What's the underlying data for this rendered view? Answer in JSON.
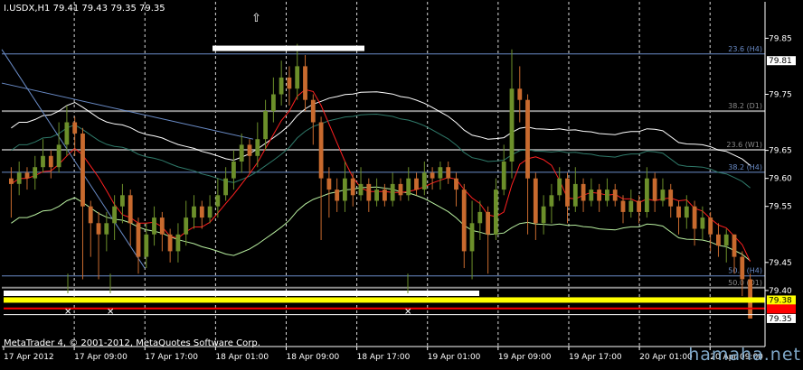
{
  "window": {
    "symbol": "I.USDX,H1",
    "ohlc": "79.41 79.43 79.35 79.35",
    "copyright": "MetaTrader 4, © 2001-2012, MetaQuotes Software Corp.",
    "watermark": "hamaha.net"
  },
  "colors": {
    "background": "#000000",
    "bull": "#6c8f2a",
    "bear": "#c86a2e",
    "fib": "#6a8cc8",
    "gray_level": "#8a8a8a",
    "red_ma": "#ff2020",
    "white_band": "#ffffff",
    "green_line": "#b9f0a0",
    "teal_band": "#2f7a6a",
    "yellow": "#ffff00",
    "red_line": "#ff0000"
  },
  "chart_data": {
    "type": "candlestick",
    "timeframe": "H1",
    "ylim": [
      79.3,
      79.915
    ],
    "y_ticks": [
      "79.85",
      "79.75",
      "79.65",
      "79.60",
      "79.55",
      "79.45",
      "79.40"
    ],
    "x_ticks": [
      "17 Apr 2012",
      "17 Apr 09:00",
      "17 Apr 17:00",
      "18 Apr 01:00",
      "18 Apr 09:00",
      "18 Apr 17:00",
      "19 Apr 01:00",
      "19 Apr 09:00",
      "19 Apr 17:00",
      "20 Apr 01:00",
      "20 Apr 09:00"
    ],
    "price_tags": [
      {
        "label": "79.81",
        "value": 79.81,
        "bg": "#ffffff",
        "fg": "#000000"
      },
      {
        "label": "79.38",
        "value": 79.383,
        "bg": "#ffff00",
        "fg": "#000000"
      },
      {
        "label": "79.35",
        "value": 79.35,
        "bg": "#ffffff",
        "fg": "#000000"
      }
    ],
    "levels": [
      {
        "label": "23.6 (H4)",
        "value": 79.822,
        "color": "#6a8cc8"
      },
      {
        "label": "38.2 (D1)",
        "value": 79.72,
        "color": "#8a8a8a"
      },
      {
        "label": "23.6 (W1)",
        "value": 79.651,
        "color": "#8a8a8a"
      },
      {
        "label": "38.2 (H4)",
        "value": 79.611,
        "color": "#6a8cc8"
      },
      {
        "label": "50.0 (H4)",
        "value": 79.426,
        "color": "#6a8cc8"
      },
      {
        "label": "50.0 (D1)",
        "value": 79.405,
        "color": "#8a8a8a"
      }
    ],
    "candles": [
      [
        79.6,
        79.59,
        79.62,
        79.53
      ],
      [
        79.59,
        79.61,
        79.63,
        79.57
      ],
      [
        79.61,
        79.6,
        79.62,
        79.58
      ],
      [
        79.6,
        79.62,
        79.64,
        79.58
      ],
      [
        79.62,
        79.64,
        79.67,
        79.61
      ],
      [
        79.64,
        79.62,
        79.65,
        79.6
      ],
      [
        79.62,
        79.66,
        79.7,
        79.61
      ],
      [
        79.66,
        79.7,
        79.73,
        79.64
      ],
      [
        79.7,
        79.68,
        79.71,
        79.64
      ],
      [
        79.68,
        79.55,
        79.69,
        79.42
      ],
      [
        79.55,
        79.52,
        79.56,
        79.46
      ],
      [
        79.52,
        79.5,
        79.54,
        79.42
      ],
      [
        79.5,
        79.52,
        79.54,
        79.47
      ],
      [
        79.52,
        79.55,
        79.57,
        79.49
      ],
      [
        79.55,
        79.57,
        79.59,
        79.52
      ],
      [
        79.57,
        79.52,
        79.58,
        79.48
      ],
      [
        79.52,
        79.46,
        79.53,
        79.43
      ],
      [
        79.46,
        79.5,
        79.52,
        79.44
      ],
      [
        79.5,
        79.53,
        79.55,
        79.48
      ],
      [
        79.53,
        79.5,
        79.54,
        79.47
      ],
      [
        79.5,
        79.47,
        79.51,
        79.45
      ],
      [
        79.47,
        79.5,
        79.52,
        79.45
      ],
      [
        79.5,
        79.53,
        79.56,
        79.48
      ],
      [
        79.53,
        79.55,
        79.57,
        79.51
      ],
      [
        79.55,
        79.53,
        79.56,
        79.51
      ],
      [
        79.53,
        79.55,
        79.57,
        79.52
      ],
      [
        79.55,
        79.57,
        79.6,
        79.53
      ],
      [
        79.57,
        79.6,
        79.62,
        79.56
      ],
      [
        79.6,
        79.63,
        79.65,
        79.58
      ],
      [
        79.63,
        79.66,
        79.68,
        79.61
      ],
      [
        79.66,
        79.64,
        79.67,
        79.61
      ],
      [
        79.64,
        79.67,
        79.7,
        79.62
      ],
      [
        79.67,
        79.72,
        79.74,
        79.65
      ],
      [
        79.72,
        79.75,
        79.78,
        79.7
      ],
      [
        79.75,
        79.78,
        79.81,
        79.73
      ],
      [
        79.78,
        79.76,
        79.8,
        79.73
      ],
      [
        79.76,
        79.8,
        79.84,
        79.74
      ],
      [
        79.8,
        79.74,
        79.82,
        79.72
      ],
      [
        79.74,
        79.7,
        79.75,
        79.66
      ],
      [
        79.7,
        79.6,
        79.71,
        79.49
      ],
      [
        79.6,
        79.58,
        79.62,
        79.53
      ],
      [
        79.58,
        79.56,
        79.6,
        79.54
      ],
      [
        79.56,
        79.6,
        79.63,
        79.54
      ],
      [
        79.6,
        79.57,
        79.61,
        79.55
      ],
      [
        79.57,
        79.59,
        79.62,
        79.56
      ],
      [
        79.59,
        79.56,
        79.6,
        79.54
      ],
      [
        79.56,
        79.58,
        79.6,
        79.55
      ],
      [
        79.58,
        79.56,
        79.59,
        79.55
      ],
      [
        79.56,
        79.59,
        79.61,
        79.55
      ],
      [
        79.59,
        79.57,
        79.6,
        79.56
      ],
      [
        79.57,
        79.6,
        79.62,
        79.56
      ],
      [
        79.6,
        79.58,
        79.61,
        79.57
      ],
      [
        79.58,
        79.61,
        79.63,
        79.57
      ],
      [
        79.61,
        79.6,
        79.62,
        79.58
      ],
      [
        79.6,
        79.62,
        79.63,
        79.58
      ],
      [
        79.62,
        79.6,
        79.63,
        79.59
      ],
      [
        79.6,
        79.58,
        79.61,
        79.55
      ],
      [
        79.58,
        79.47,
        79.59,
        79.44
      ],
      [
        79.47,
        79.52,
        79.56,
        79.42
      ],
      [
        79.52,
        79.54,
        79.56,
        79.49
      ],
      [
        79.54,
        79.5,
        79.55,
        79.43
      ],
      [
        79.5,
        79.58,
        79.6,
        79.49
      ],
      [
        79.58,
        79.63,
        79.66,
        79.57
      ],
      [
        79.63,
        79.76,
        79.83,
        79.6
      ],
      [
        79.76,
        79.74,
        79.8,
        79.7
      ],
      [
        79.74,
        79.6,
        79.75,
        79.5
      ],
      [
        79.6,
        79.52,
        79.61,
        79.49
      ],
      [
        79.52,
        79.55,
        79.57,
        79.5
      ],
      [
        79.55,
        79.57,
        79.59,
        79.52
      ],
      [
        79.57,
        79.6,
        79.62,
        79.56
      ],
      [
        79.6,
        79.55,
        79.61,
        79.52
      ],
      [
        79.55,
        79.59,
        79.62,
        79.54
      ],
      [
        79.59,
        79.56,
        79.6,
        79.54
      ],
      [
        79.56,
        79.58,
        79.6,
        79.55
      ],
      [
        79.58,
        79.56,
        79.59,
        79.54
      ],
      [
        79.56,
        79.58,
        79.6,
        79.55
      ],
      [
        79.58,
        79.56,
        79.59,
        79.55
      ],
      [
        79.56,
        79.54,
        79.57,
        79.52
      ],
      [
        79.54,
        79.56,
        79.58,
        79.53
      ],
      [
        79.56,
        79.54,
        79.57,
        79.52
      ],
      [
        79.54,
        79.6,
        79.62,
        79.53
      ],
      [
        79.6,
        79.56,
        79.61,
        79.54
      ],
      [
        79.56,
        79.58,
        79.6,
        79.55
      ],
      [
        79.58,
        79.55,
        79.59,
        79.53
      ],
      [
        79.55,
        79.53,
        79.56,
        79.5
      ],
      [
        79.53,
        79.55,
        79.57,
        79.51
      ],
      [
        79.55,
        79.51,
        79.56,
        79.48
      ],
      [
        79.51,
        79.53,
        79.55,
        79.49
      ],
      [
        79.53,
        79.5,
        79.54,
        79.47
      ],
      [
        79.5,
        79.48,
        79.52,
        79.46
      ],
      [
        79.48,
        79.5,
        79.51,
        79.45
      ],
      [
        79.5,
        79.46,
        79.5,
        79.43
      ],
      [
        79.46,
        79.42,
        79.47,
        79.39
      ],
      [
        79.42,
        79.35,
        79.43,
        79.35
      ]
    ]
  }
}
